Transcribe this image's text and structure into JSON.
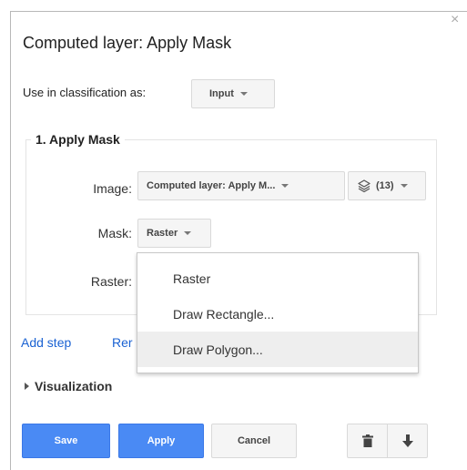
{
  "dialog": {
    "title": "Computed layer: Apply Mask",
    "close_glyph": "×"
  },
  "classification": {
    "label": "Use in classification as:",
    "selected": "Input"
  },
  "step": {
    "legend": "1. Apply Mask",
    "image_label": "Image:",
    "image_value": "Computed layer: Apply M...",
    "layers_count": "(13)",
    "mask_label": "Mask:",
    "mask_value": "Raster",
    "raster_label": "Raster:"
  },
  "mask_menu": {
    "items": [
      "Raster",
      "Draw Rectangle...",
      "Draw Polygon..."
    ],
    "highlighted_index": 2
  },
  "links": {
    "add_step": "Add step",
    "remove_step_partial": "Rer"
  },
  "visualization": {
    "label": "Visualization"
  },
  "buttons": {
    "save": "Save",
    "apply": "Apply",
    "cancel": "Cancel"
  },
  "icons": {
    "trash": "trash-icon",
    "move_down": "arrow-down-icon",
    "layers": "layers-icon"
  },
  "colors": {
    "primary": "#4a8af4",
    "link": "#1a62d3",
    "highlight": "#eeeeee"
  }
}
